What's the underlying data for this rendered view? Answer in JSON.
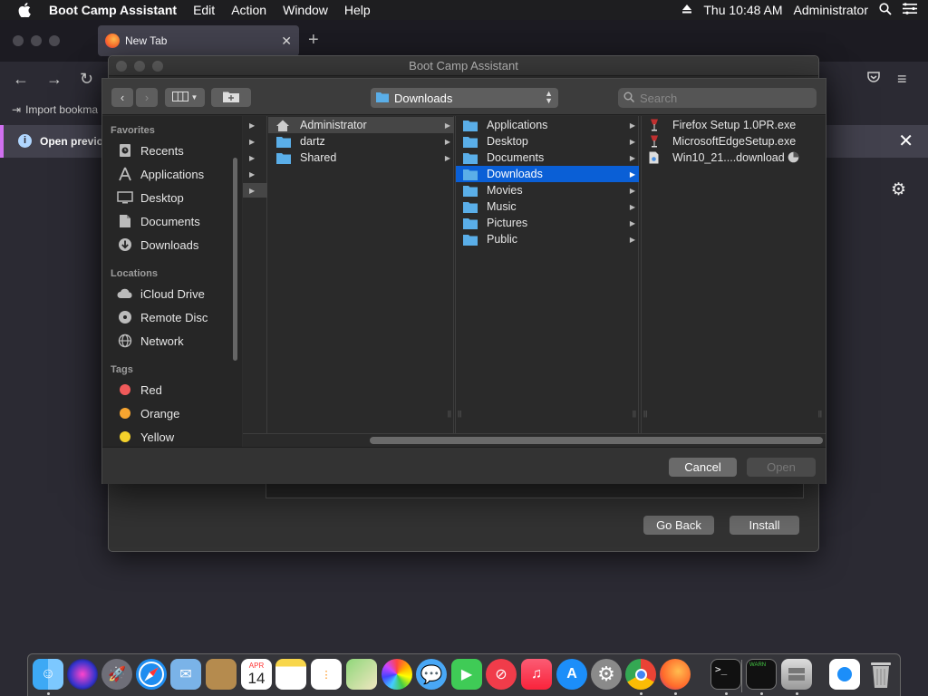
{
  "menubar": {
    "app_name": "Boot Camp Assistant",
    "menus": [
      "Edit",
      "Action",
      "Window",
      "Help"
    ],
    "clock": "Thu 10:48 AM",
    "user": "Administrator"
  },
  "firefox": {
    "tab_title": "New Tab",
    "bookmark_label": "Import bookma",
    "info_text": "Open previo"
  },
  "bootcamp": {
    "window_title": "Boot Camp Assistant",
    "go_back_label": "Go Back",
    "install_label": "Install"
  },
  "dialog": {
    "path_popup": "Downloads",
    "search_placeholder": "Search",
    "sidebar": {
      "favorites_heading": "Favorites",
      "favorites": [
        {
          "label": "Recents",
          "icon": "clock-icon"
        },
        {
          "label": "Applications",
          "icon": "applications-icon"
        },
        {
          "label": "Desktop",
          "icon": "desktop-icon"
        },
        {
          "label": "Documents",
          "icon": "document-icon"
        },
        {
          "label": "Downloads",
          "icon": "download-icon"
        }
      ],
      "locations_heading": "Locations",
      "locations": [
        {
          "label": "iCloud Drive",
          "icon": "cloud-icon"
        },
        {
          "label": "Remote Disc",
          "icon": "disc-icon"
        },
        {
          "label": "Network",
          "icon": "globe-icon"
        }
      ],
      "tags_heading": "Tags",
      "tags": [
        {
          "label": "Red",
          "color": "#f05a5a"
        },
        {
          "label": "Orange",
          "color": "#f7a530"
        },
        {
          "label": "Yellow",
          "color": "#f4d22b"
        }
      ]
    },
    "columns": {
      "users": [
        "Administrator",
        "dartz",
        "Shared"
      ],
      "home": [
        "Applications",
        "Desktop",
        "Documents",
        "Downloads",
        "Movies",
        "Music",
        "Pictures",
        "Public"
      ],
      "downloads": [
        "Firefox Setup 1.0PR.exe",
        "MicrosoftEdgeSetup.exe",
        "Win10_21....download"
      ]
    },
    "selected_home_item": "Downloads",
    "cancel_label": "Cancel",
    "open_label": "Open"
  },
  "dock": {
    "apps": [
      "Finder",
      "Siri",
      "Launchpad",
      "Safari",
      "Mail",
      "Contacts",
      "Calendar",
      "Notes",
      "Reminders",
      "Maps",
      "Photos",
      "Messages",
      "FaceTime",
      "News",
      "Music",
      "App Store",
      "System Preferences",
      "Chrome",
      "Firefox",
      "Terminal",
      "Console",
      "Boot Camp Assistant",
      "Downloads",
      "Trash"
    ],
    "calendar_month": "APR",
    "calendar_day": "14"
  },
  "colors": {
    "selection": "#0a5fd6",
    "folder": "#5aaee8",
    "dialog_bg": "#2d2d2d"
  }
}
